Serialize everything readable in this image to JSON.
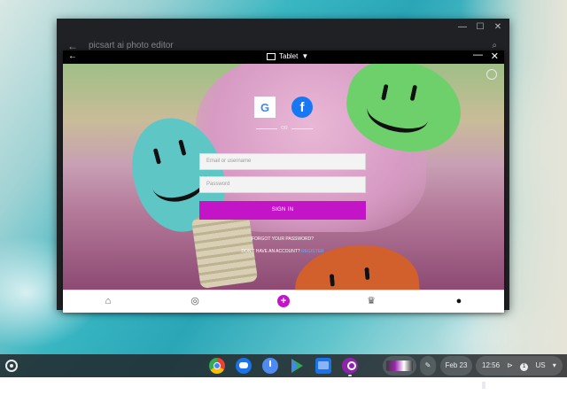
{
  "outer_window": {
    "title": "picsart ai photo editor",
    "minimize_glyph": "—",
    "maximize_glyph": "☐",
    "close_glyph": "✕",
    "back_glyph": "←",
    "search_glyph": "⌕"
  },
  "inner_window": {
    "header_label": "Tablet",
    "header_caret": "▼",
    "back_glyph": "←",
    "minimize_glyph": "—",
    "close_glyph": "✕"
  },
  "login": {
    "google_letter": "G",
    "facebook_letter": "f",
    "or_label": "OR",
    "email_placeholder": "Email or username",
    "password_placeholder": "Password",
    "signin_label": "SIGN IN",
    "forgot_label": "FORGOT YOUR PASSWORD?",
    "no_account_label": "DON'T HAVE AN ACCOUNT?",
    "register_label": "REGISTER"
  },
  "bottom_nav": {
    "home_icon": "⌂",
    "explore_icon": "◎",
    "plus_icon": "+",
    "trophy_icon": "♛",
    "profile_icon": "●"
  },
  "shelf": {
    "holding_space_label": "⇥",
    "date": "Feb 23",
    "time": "12:56",
    "notification_count": "1",
    "locale": "US",
    "apps": [
      "chrome",
      "messages",
      "clock",
      "play-store",
      "files",
      "picsart"
    ]
  },
  "colors": {
    "accent": "#c414c8",
    "register_link": "#4db6ff"
  }
}
